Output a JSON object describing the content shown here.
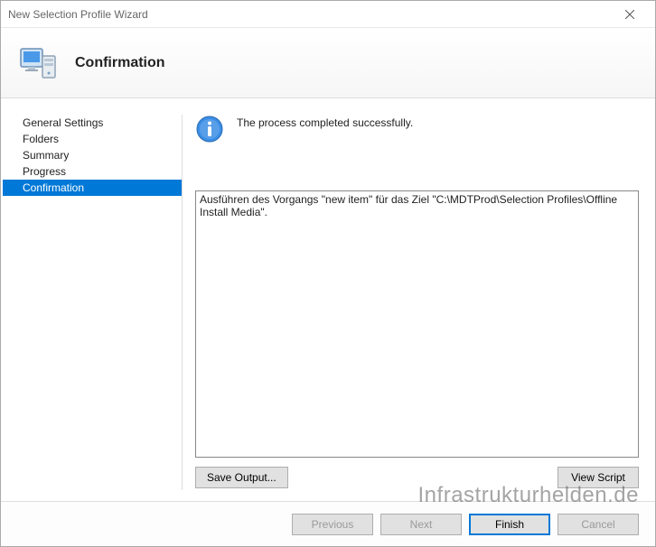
{
  "window": {
    "title": "New Selection Profile Wizard"
  },
  "header": {
    "title": "Confirmation"
  },
  "sidebar": {
    "items": [
      {
        "label": "General Settings",
        "selected": false
      },
      {
        "label": "Folders",
        "selected": false
      },
      {
        "label": "Summary",
        "selected": false
      },
      {
        "label": "Progress",
        "selected": false
      },
      {
        "label": "Confirmation",
        "selected": true
      }
    ]
  },
  "main": {
    "status_text": "The process completed successfully.",
    "log_text": "Ausführen des Vorgangs \"new item\" für das Ziel \"C:\\MDTProd\\Selection Profiles\\Offline Install Media\".",
    "save_output_label": "Save Output...",
    "view_script_label": "View Script"
  },
  "footer": {
    "previous_label": "Previous",
    "next_label": "Next",
    "finish_label": "Finish",
    "cancel_label": "Cancel"
  },
  "watermark": "Infrastrukturhelden.de"
}
